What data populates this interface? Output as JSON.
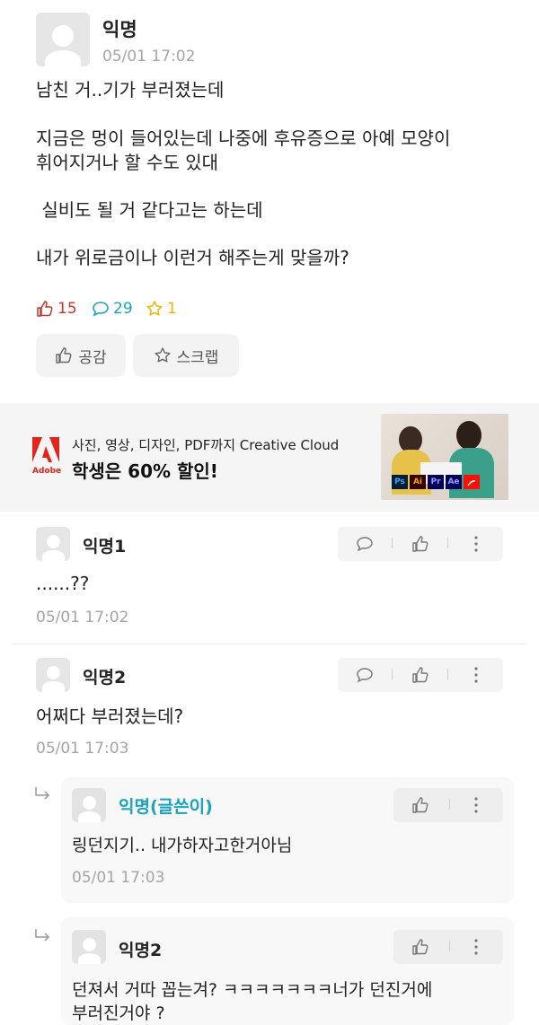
{
  "post": {
    "author": "익명",
    "time": "05/01 17:02",
    "lines": [
      "남친 거..기가 부러졌는데",
      "지금은 멍이 들어있는데 나중에 후유증으로 아예 모양이",
      "휘어지거나 할 수도 있대",
      " 실비도 될 거 같다고는 하는데",
      "내가 위로금이나 이런거 해주는게 맞을까?"
    ],
    "stats": {
      "likes": "15",
      "comments": "29",
      "scraps": "1"
    },
    "buttons": {
      "like": "공감",
      "scrap": "스크랩"
    }
  },
  "ad": {
    "brand": "Adobe",
    "line1": "사진, 영상, 디자인, PDF까지 Creative Cloud",
    "line2": "학생은 60% 할인!",
    "apps": [
      "Ps",
      "Ai",
      "Pr",
      "Ae"
    ]
  },
  "comments": [
    {
      "author": "익명1",
      "text": "......??",
      "time": "05/01 17:02"
    },
    {
      "author": "익명2",
      "text": "어쩌다 부러졌는데?",
      "time": "05/01 17:03"
    }
  ],
  "replies": [
    {
      "author": "익명(글쓴이)",
      "text": "링던지기.. 내가하자고한거아님",
      "time": "05/01 17:03"
    },
    {
      "author": "익명2",
      "text1": "던져서 거따 꼽는겨? ㅋㅋㅋㅋㅋㅋㅋ너가 던진거에",
      "text2": "부러진거야 ?"
    }
  ],
  "colors": {
    "like_red": "#c0392b",
    "comment_cyan": "#1aa3c0",
    "scrap_yellow": "#f0b400",
    "op_name": "#1aa3c0",
    "adobe_red": "#e1251b"
  }
}
